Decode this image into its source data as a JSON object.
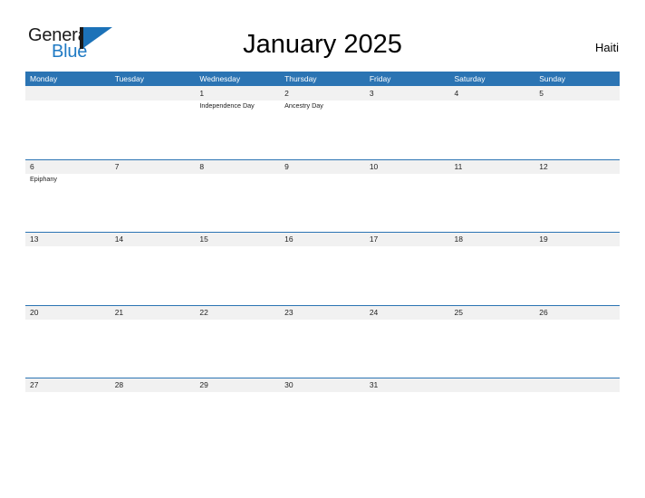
{
  "brand": {
    "name_part1": "General",
    "name_part2": "Blue",
    "flag_icon": "general-blue-flag-logo",
    "accent_color": "#1c72b8"
  },
  "header": {
    "title": "January 2025",
    "region": "Haiti"
  },
  "theme": {
    "header_blue": "#2b74b3",
    "band_gray": "#f1f1f1",
    "text_dark": "#232323",
    "logo_blue": "#1f7ac4",
    "page_background": "#ffffff"
  },
  "calendar": {
    "month": "January",
    "year": "2025",
    "weekday_headers": [
      "Monday",
      "Tuesday",
      "Wednesday",
      "Thursday",
      "Friday",
      "Saturday",
      "Sunday"
    ],
    "weeks": [
      {
        "days": [
          {
            "num": "",
            "events": []
          },
          {
            "num": "",
            "events": []
          },
          {
            "num": "1",
            "events": [
              "Independence Day"
            ]
          },
          {
            "num": "2",
            "events": [
              "Ancestry Day"
            ]
          },
          {
            "num": "3",
            "events": []
          },
          {
            "num": "4",
            "events": []
          },
          {
            "num": "5",
            "events": []
          }
        ]
      },
      {
        "days": [
          {
            "num": "6",
            "events": [
              "Epiphany"
            ]
          },
          {
            "num": "7",
            "events": []
          },
          {
            "num": "8",
            "events": []
          },
          {
            "num": "9",
            "events": []
          },
          {
            "num": "10",
            "events": []
          },
          {
            "num": "11",
            "events": []
          },
          {
            "num": "12",
            "events": []
          }
        ]
      },
      {
        "days": [
          {
            "num": "13",
            "events": []
          },
          {
            "num": "14",
            "events": []
          },
          {
            "num": "15",
            "events": []
          },
          {
            "num": "16",
            "events": []
          },
          {
            "num": "17",
            "events": []
          },
          {
            "num": "18",
            "events": []
          },
          {
            "num": "19",
            "events": []
          }
        ]
      },
      {
        "days": [
          {
            "num": "20",
            "events": []
          },
          {
            "num": "21",
            "events": []
          },
          {
            "num": "22",
            "events": []
          },
          {
            "num": "23",
            "events": []
          },
          {
            "num": "24",
            "events": []
          },
          {
            "num": "25",
            "events": []
          },
          {
            "num": "26",
            "events": []
          }
        ]
      },
      {
        "days": [
          {
            "num": "27",
            "events": []
          },
          {
            "num": "28",
            "events": []
          },
          {
            "num": "29",
            "events": []
          },
          {
            "num": "30",
            "events": []
          },
          {
            "num": "31",
            "events": []
          },
          {
            "num": "",
            "events": []
          },
          {
            "num": "",
            "events": []
          }
        ]
      }
    ]
  }
}
